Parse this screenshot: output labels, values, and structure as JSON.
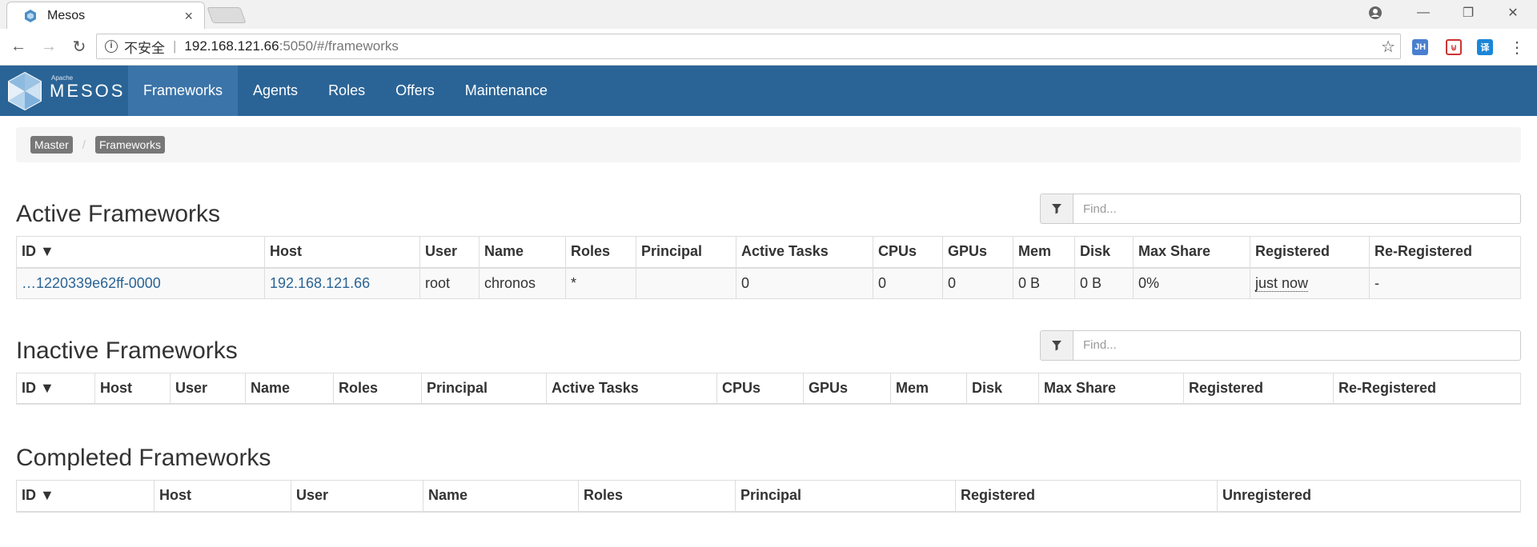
{
  "browser": {
    "tab_title": "Mesos",
    "url_insecure": "不安全",
    "url_host": "192.168.121.66",
    "url_rest": ":5050/#/frameworks",
    "ext_jh": "JH",
    "ext_translate": "译"
  },
  "navbar": {
    "brand_small": "Apache",
    "brand": "MESOS",
    "links": [
      "Frameworks",
      "Agents",
      "Roles",
      "Offers",
      "Maintenance"
    ]
  },
  "breadcrumb": [
    "Master",
    "Frameworks"
  ],
  "active": {
    "title": "Active Frameworks",
    "find_placeholder": "Find...",
    "columns": [
      "ID ▼",
      "Host",
      "User",
      "Name",
      "Roles",
      "Principal",
      "Active Tasks",
      "CPUs",
      "GPUs",
      "Mem",
      "Disk",
      "Max Share",
      "Registered",
      "Re-Registered"
    ],
    "rows": [
      [
        "…1220339e62ff-0000",
        "192.168.121.66",
        "root",
        "chronos",
        "*",
        "",
        "0",
        "0",
        "0",
        "0 B",
        "0 B",
        "0%",
        "just now",
        "-"
      ]
    ]
  },
  "inactive": {
    "title": "Inactive Frameworks",
    "find_placeholder": "Find...",
    "columns": [
      "ID ▼",
      "Host",
      "User",
      "Name",
      "Roles",
      "Principal",
      "Active Tasks",
      "CPUs",
      "GPUs",
      "Mem",
      "Disk",
      "Max Share",
      "Registered",
      "Re-Registered"
    ]
  },
  "completed": {
    "title": "Completed Frameworks",
    "columns": [
      "ID ▼",
      "Host",
      "User",
      "Name",
      "Roles",
      "Principal",
      "Registered",
      "Unregistered"
    ]
  },
  "colors": {
    "navbar": "#2a6496",
    "navbar_active": "#3b74a8",
    "link": "#2a6496"
  }
}
